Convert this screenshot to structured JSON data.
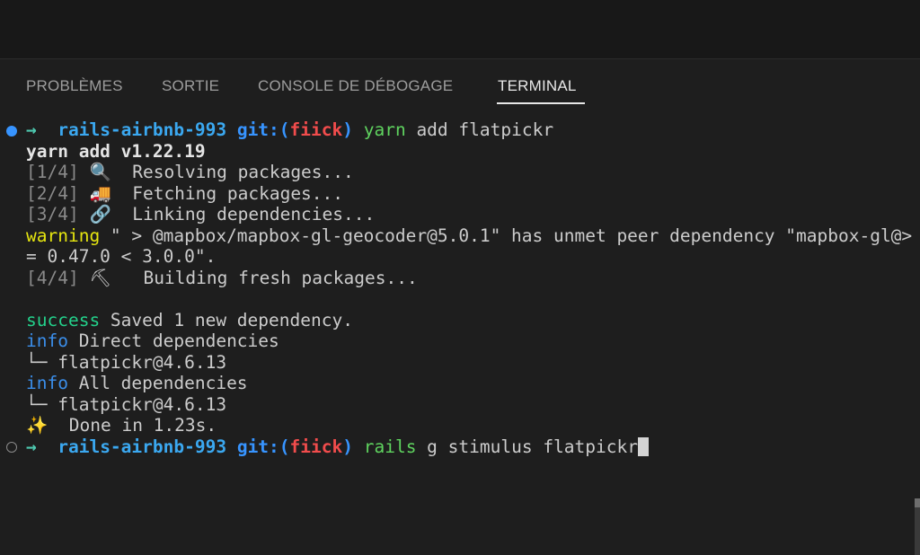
{
  "panel": {
    "tabs": [
      {
        "label": "PROBLÈMES",
        "active": false
      },
      {
        "label": "SORTIE",
        "active": false
      },
      {
        "label": "CONSOLE DE DÉBOGAGE",
        "active": false
      },
      {
        "label": "TERMINAL",
        "active": true
      }
    ]
  },
  "terminal": {
    "prompt1": {
      "arrow": "→",
      "dir": "rails-airbnb-993",
      "git_prefix": "git:(",
      "branch": "fiick",
      "git_suffix": ")",
      "command": "yarn",
      "args": " add flatpickr"
    },
    "yarn_version": "yarn add v1.22.19",
    "steps": [
      {
        "num": "[1/4]",
        "icon": "🔍",
        "text": "Resolving packages..."
      },
      {
        "num": "[2/4]",
        "icon": "🚚",
        "text": "Fetching packages..."
      },
      {
        "num": "[3/4]",
        "icon": "🔗",
        "text": "Linking dependencies..."
      }
    ],
    "warning": {
      "label": "warning",
      "text": " \" > @mapbox/mapbox-gl-geocoder@5.0.1\" has unmet peer dependency \"mapbox-gl@>",
      "continuation": "= 0.47.0 < 3.0.0\"."
    },
    "step4": {
      "num": "[4/4]",
      "icon": "⛏",
      "text": "Building fresh packages..."
    },
    "success": {
      "label": "success",
      "text": " Saved 1 new dependency."
    },
    "info1": {
      "label": "info",
      "text": " Direct dependencies"
    },
    "tree1": "└─ flatpickr@4.6.13",
    "info2": {
      "label": "info",
      "text": " All dependencies"
    },
    "tree2": "└─ flatpickr@4.6.13",
    "done": {
      "icon": "✨",
      "text": "  Done in 1.23s."
    },
    "prompt2": {
      "arrow": "→",
      "dir": "rails-airbnb-993",
      "git_prefix": "git:(",
      "branch": "fiick",
      "git_suffix": ")",
      "command": "rails",
      "args": " g stimulus flatpickr"
    }
  }
}
